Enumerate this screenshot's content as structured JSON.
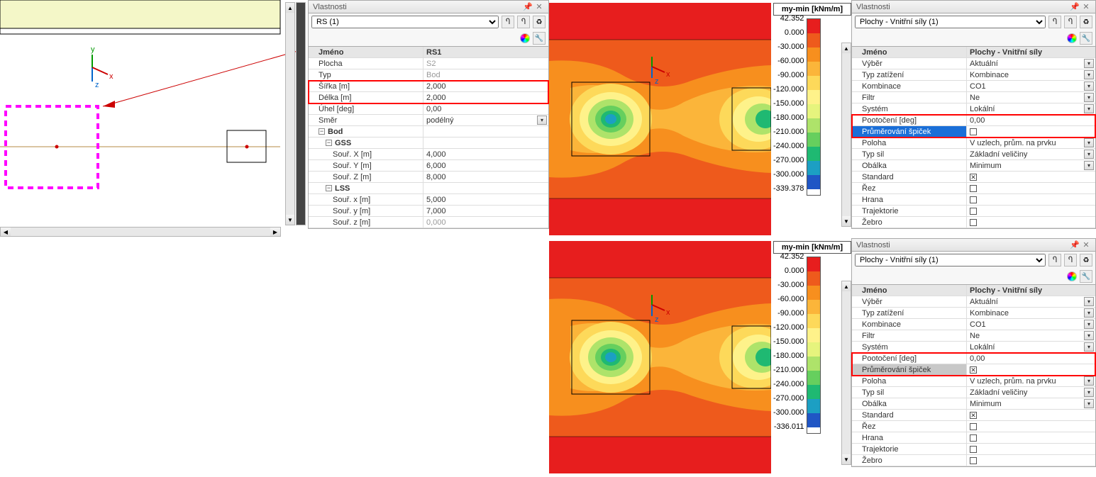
{
  "panel1": {
    "title": "Vlastnosti",
    "selector": "RS (1)",
    "rows": {
      "jmeno_k": "Jméno",
      "jmeno_v": "RS1",
      "plocha_k": "Plocha",
      "plocha_v": "S2",
      "typ_k": "Typ",
      "typ_v": "Bod",
      "sirka_k": "Šířka [m]",
      "sirka_v": "2,000",
      "delka_k": "Délka [m]",
      "delka_v": "2,000",
      "uhel_k": "Úhel [deg]",
      "uhel_v": "0,00",
      "smer_k": "Směr",
      "smer_v": "podélný",
      "bod_k": "Bod",
      "gss_k": "GSS",
      "sx_k": "Souř. X [m]",
      "sx_v": "4,000",
      "sy_k": "Souř. Y [m]",
      "sy_v": "6,000",
      "sz_k": "Souř. Z [m]",
      "sz_v": "8,000",
      "lss_k": "LSS",
      "lx_k": "Souř. x [m]",
      "lx_v": "5,000",
      "ly_k": "Souř. y [m]",
      "ly_v": "7,000",
      "lz_k": "Souř. z [m]",
      "lz_v": "0,000"
    }
  },
  "panel2": {
    "title": "Vlastnosti",
    "selector": "Plochy - Vnitřní síly (1)",
    "rows": {
      "jmeno_k": "Jméno",
      "jmeno_v": "Plochy - Vnitřní síly",
      "vyber_k": "Výběr",
      "vyber_v": "Aktuální",
      "typz_k": "Typ zatížení",
      "typz_v": "Kombinace",
      "komb_k": "Kombinace",
      "komb_v": "CO1",
      "filtr_k": "Filtr",
      "filtr_v": "Ne",
      "system_k": "Systém",
      "system_v": "Lokální",
      "poot_k": "Pootočení [deg]",
      "poot_v": "0,00",
      "prum_k": "Průměrování špiček",
      "poloha_k": "Poloha",
      "poloha_v": "V uzlech, prům. na prvku",
      "typsil_k": "Typ sil",
      "typsil_v": "Základní veličiny",
      "obalka_k": "Obálka",
      "obalka_v": "Minimum",
      "standard_k": "Standard",
      "rez_k": "Řez",
      "hrana_k": "Hrana",
      "traj_k": "Trajektorie",
      "zebro_k": "Žebro"
    }
  },
  "legend": {
    "title": "my-min [kNm/m]",
    "vals_a": [
      "42.352",
      "0.000",
      "-30.000",
      "-60.000",
      "-90.000",
      "-120.000",
      "-150.000",
      "-180.000",
      "-210.000",
      "-240.000",
      "-270.000",
      "-300.000",
      "-339.378"
    ],
    "vals_b": [
      "42.352",
      "0.000",
      "-30.000",
      "-60.000",
      "-90.000",
      "-120.000",
      "-150.000",
      "-180.000",
      "-210.000",
      "-240.000",
      "-270.000",
      "-300.000",
      "-336.011"
    ],
    "colors": [
      "#e71e1e",
      "#ee5a1c",
      "#f78f1e",
      "#fbb53a",
      "#fdd95a",
      "#fef28a",
      "#e6f47d",
      "#aee36a",
      "#66cf5e",
      "#1fb972",
      "#1c9fc3",
      "#2056c5"
    ]
  },
  "chart_data": [
    {
      "type": "heatmap",
      "title": "my-min [kNm/m]",
      "variant": "Průměrování špiček = off",
      "value_range": [
        -339.378,
        42.352
      ],
      "contour_levels": [
        42.352,
        0,
        -30,
        -60,
        -90,
        -120,
        -150,
        -180,
        -210,
        -240,
        -270,
        -300,
        -339.378
      ],
      "colormap": [
        "#e71e1e",
        "#ee5a1c",
        "#f78f1e",
        "#fbb53a",
        "#fdd95a",
        "#fef28a",
        "#e6f47d",
        "#aee36a",
        "#66cf5e",
        "#1fb972",
        "#1c9fc3",
        "#2056c5"
      ],
      "peaks": [
        {
          "approx_center": "left-column",
          "min_value": -339.378
        },
        {
          "approx_center": "right-column",
          "min_value": -300
        }
      ]
    },
    {
      "type": "heatmap",
      "title": "my-min [kNm/m]",
      "variant": "Průměrování špiček = on",
      "value_range": [
        -336.011,
        42.352
      ],
      "contour_levels": [
        42.352,
        0,
        -30,
        -60,
        -90,
        -120,
        -150,
        -180,
        -210,
        -240,
        -270,
        -300,
        -336.011
      ],
      "colormap": [
        "#e71e1e",
        "#ee5a1c",
        "#f78f1e",
        "#fbb53a",
        "#fdd95a",
        "#fef28a",
        "#e6f47d",
        "#aee36a",
        "#66cf5e",
        "#1fb972",
        "#1c9fc3",
        "#2056c5"
      ],
      "peaks": [
        {
          "approx_center": "left-column",
          "min_value": -336.011
        },
        {
          "approx_center": "right-column",
          "min_value": -300
        }
      ]
    }
  ]
}
